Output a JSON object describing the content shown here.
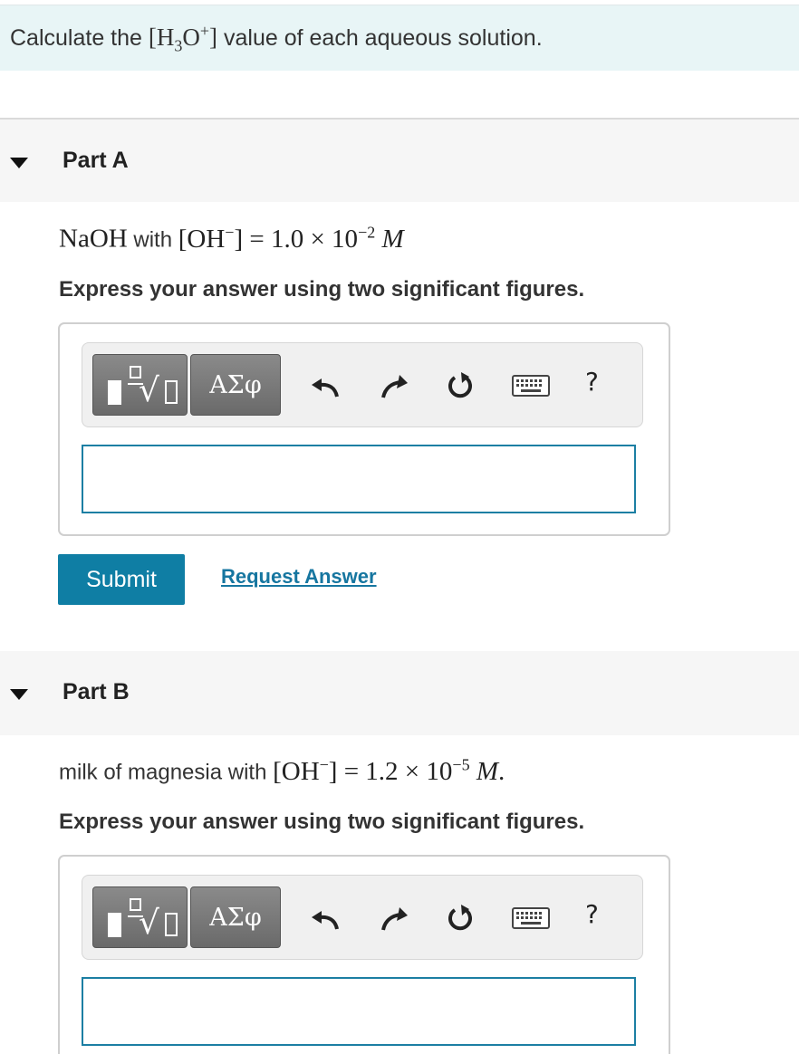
{
  "intro": {
    "prefix": "Calculate the",
    "expression": "[H₃O⁺]",
    "suffix": "value of each aqueous solution."
  },
  "parts": [
    {
      "title": "Part A",
      "question_prefix": "NaOH",
      "question_mid": "with",
      "question_math": "[OH⁻] = 1.0 × 10⁻² M",
      "instruction": "Express your answer using two significant figures.",
      "answer_value": ""
    },
    {
      "title": "Part B",
      "question_prefix": "milk of magnesia with",
      "question_math": "[OH⁻] = 1.2 × 10⁻⁵ M.",
      "instruction": "Express your answer using two significant figures.",
      "answer_value": ""
    }
  ],
  "toolbar": {
    "symbols_label": "ΑΣφ",
    "help_label": "?",
    "icons": [
      "templates-icon",
      "undo-icon",
      "redo-icon",
      "reset-icon",
      "keyboard-icon",
      "help-icon"
    ]
  },
  "actions": {
    "submit_label": "Submit",
    "request_label": "Request Answer"
  },
  "colors": {
    "intro_bg": "#e8f5f6",
    "header_bg": "#f6f6f6",
    "accent": "#0f7ea4",
    "link": "#1676a0",
    "input_border": "#1c7fa3"
  }
}
